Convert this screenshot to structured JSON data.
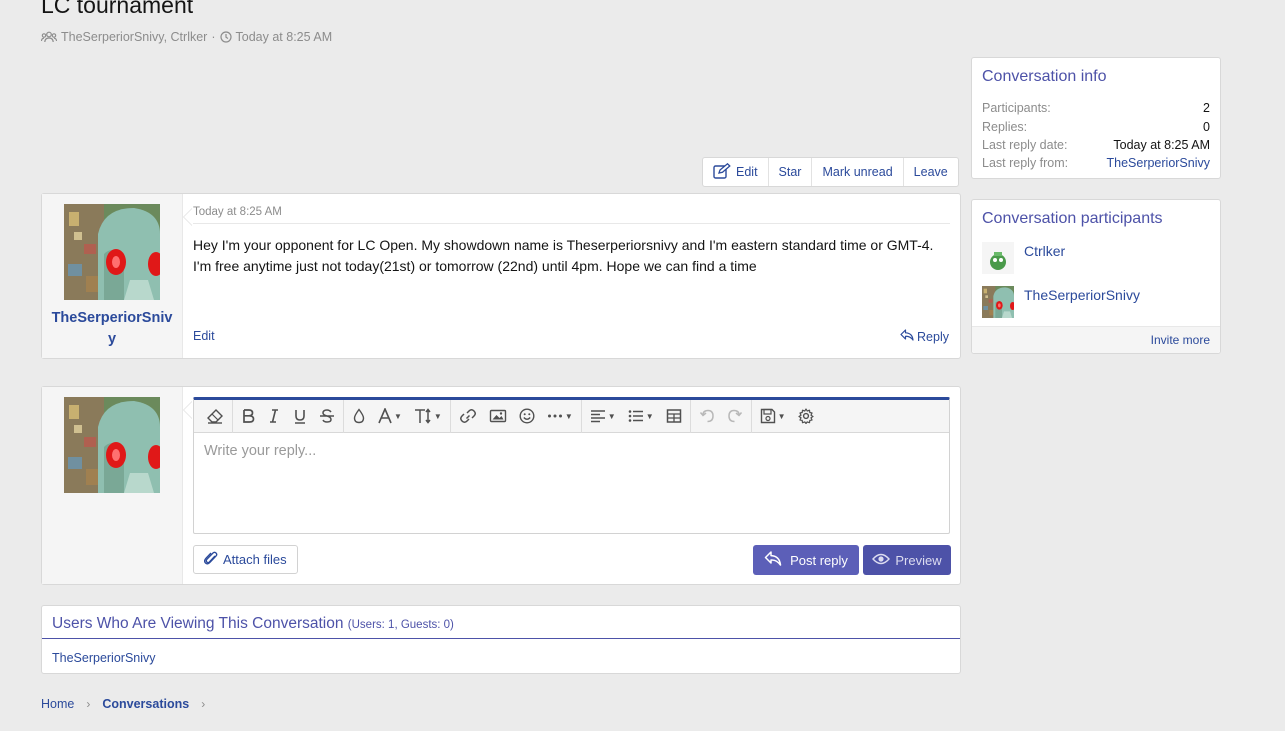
{
  "title": "LC tournament",
  "meta": {
    "participants": "TheSerperiorSnivy, Ctrlker",
    "separator": "·",
    "time": "Today at 8:25 AM"
  },
  "actions": {
    "edit": "Edit",
    "star": "Star",
    "mark_unread": "Mark unread",
    "leave": "Leave"
  },
  "message": {
    "author": "TheSerperiorSnivy",
    "date": "Today at 8:25 AM",
    "body": "Hey I'm your opponent for LC Open. My showdown name is Theserperiorsnivy and I'm eastern standard time or GMT-4. I'm free anytime just not today(21st) or tomorrow (22nd) until 4pm. Hope we can find a time",
    "edit": "Edit",
    "reply": "Reply"
  },
  "reply_form": {
    "placeholder": "Write your reply...",
    "attach": "Attach files",
    "post": "Post reply",
    "preview": "Preview"
  },
  "viewers": {
    "title": "Users Who Are Viewing This Conversation",
    "count": "(Users: 1, Guests: 0)",
    "users": "TheSerperiorSnivy"
  },
  "breadcrumb": {
    "home": "Home",
    "conversations": "Conversations",
    "chevron": "›"
  },
  "conversation_info": {
    "title": "Conversation info",
    "participants_label": "Participants:",
    "participants_value": "2",
    "replies_label": "Replies:",
    "replies_value": "0",
    "last_reply_date_label": "Last reply date:",
    "last_reply_date_value": "Today at 8:25 AM",
    "last_reply_from_label": "Last reply from:",
    "last_reply_from_value": "TheSerperiorSnivy"
  },
  "participants_panel": {
    "title": "Conversation participants",
    "members": [
      "Ctrlker",
      "TheSerperiorSnivy"
    ],
    "invite": "Invite more"
  },
  "colors": {
    "link": "#2b4a9b",
    "accent": "#4d52a8",
    "button": "#5c5fb8",
    "background": "#ebebeb"
  },
  "icons": [
    "users-icon",
    "clock-icon",
    "edit-icon",
    "reply-icon",
    "paperclip-icon",
    "eye-icon"
  ]
}
